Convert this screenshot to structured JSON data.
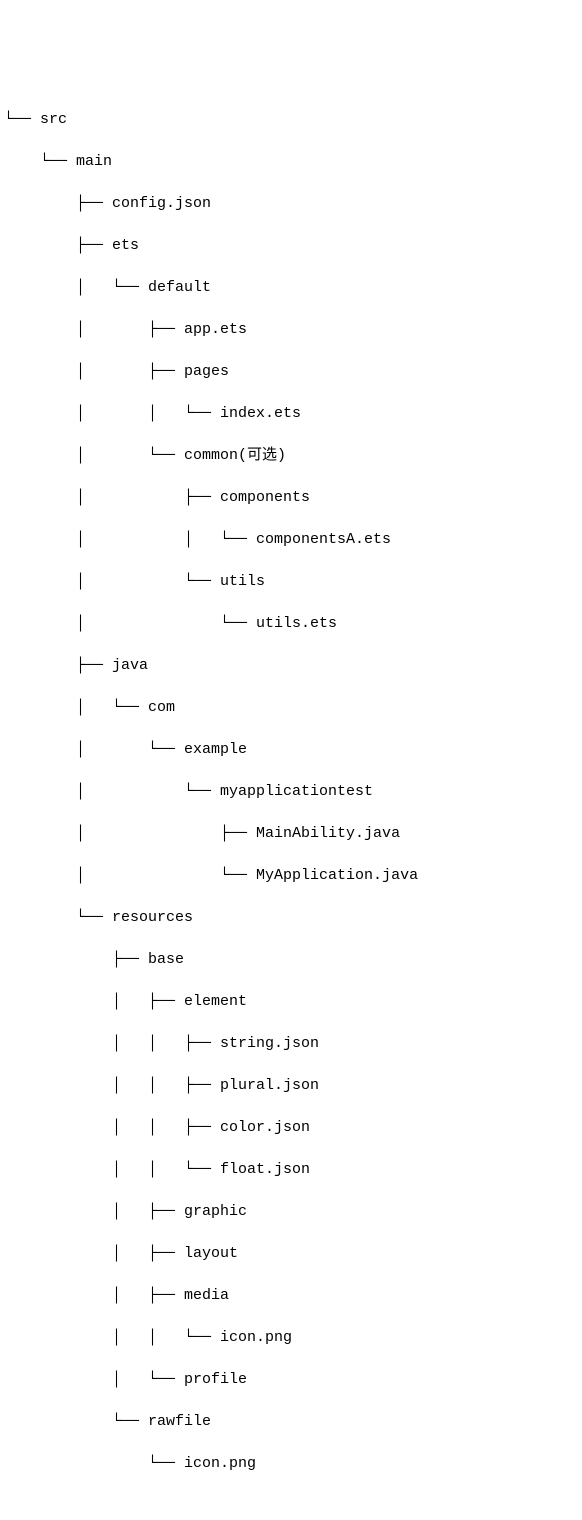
{
  "tree": {
    "root": "src",
    "lines": [
      "└── src",
      "    └── main",
      "        ├── config.json",
      "        ├── ets",
      "        │   └── default",
      "        │       ├── app.ets",
      "        │       ├── pages",
      "        │       │   └── index.ets",
      "        │       └── common(可选)",
      "        │           ├── components",
      "        │           │   └── componentsA.ets",
      "        │           └── utils",
      "        │               └── utils.ets",
      "        ├── java",
      "        │   └── com",
      "        │       └── example",
      "        │           └── myapplicationtest",
      "        │               ├── MainAbility.java",
      "        │               └── MyApplication.java",
      "        └── resources",
      "            ├── base",
      "            │   ├── element",
      "            │   │   ├── string.json",
      "            │   │   ├── plural.json",
      "            │   │   ├── color.json",
      "            │   │   └── float.json",
      "            │   ├── graphic",
      "            │   ├── layout",
      "            │   ├── media",
      "            │   │   └── icon.png",
      "            │   └── profile",
      "            └── rawfile",
      "                └── icon.png"
    ]
  }
}
